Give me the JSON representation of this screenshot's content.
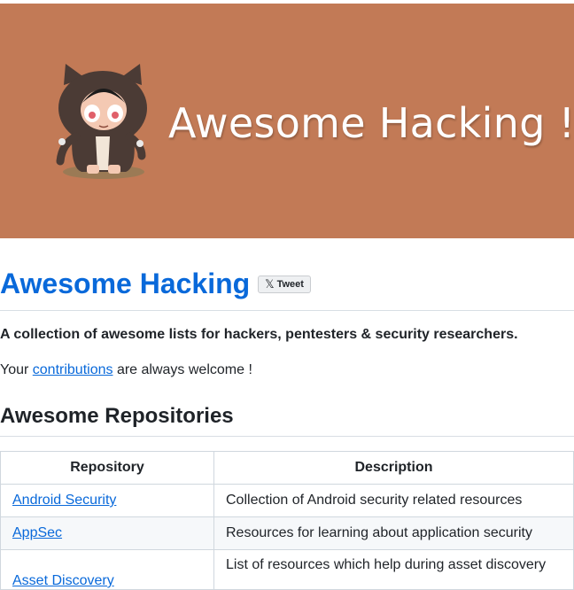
{
  "banner": {
    "title": "Awesome Hacking !",
    "background": "#c27a56",
    "illustration": "octocat-hoodie-mascot"
  },
  "header": {
    "title": "Awesome Hacking",
    "tweet_button": {
      "label": "Tweet",
      "icon": "x-logo-icon"
    }
  },
  "intro": {
    "tagline": "A collection of awesome lists for hackers, pentesters & security researchers.",
    "welcome_prefix": "Your ",
    "welcome_link": "contributions",
    "welcome_suffix": " are always welcome !"
  },
  "section": {
    "title": "Awesome Repositories"
  },
  "table": {
    "headers": [
      "Repository",
      "Description"
    ],
    "rows": [
      {
        "repo": "Android Security",
        "desc": "Collection of Android security related resources"
      },
      {
        "repo": "AppSec",
        "desc": "Resources for learning about application security"
      },
      {
        "repo": "Asset Discovery",
        "desc": "List of resources which help during asset discovery"
      }
    ]
  },
  "colors": {
    "link": "#0969da",
    "text": "#1f2328",
    "border": "#d0d7de"
  }
}
